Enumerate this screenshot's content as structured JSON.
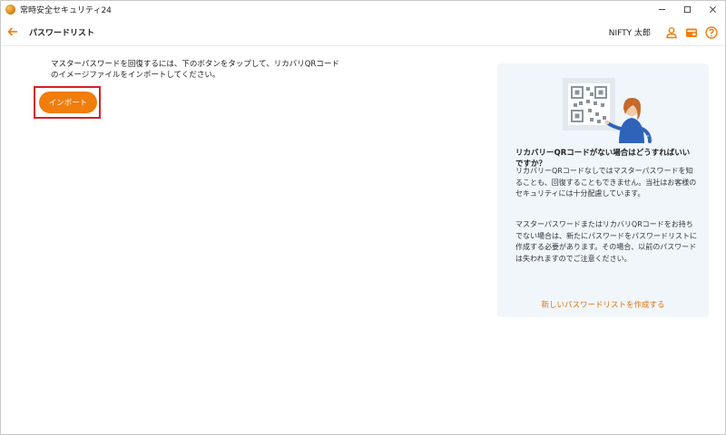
{
  "window": {
    "title": "常時安全セキュリティ24"
  },
  "header": {
    "title": "パスワードリスト",
    "user_name": "NIFTY 太郎"
  },
  "main": {
    "instruction": "マスターパスワードを回復するには、下のボタンをタップして、リカバリQRコードのイメージファイルをインポートしてください。",
    "import_label": "インポート"
  },
  "info_card": {
    "title": "リカバリーQRコードがない場合はどうすればいいですか？",
    "paragraph1": "リカバリーQRコードなしではマスターパスワードを知ることも、回復することもできません。当社はお客様のセキュリティには十分配慮しています。",
    "paragraph2": "マスターパスワードまたはリカバリQRコードをお持ちでない場合は、新たにパスワードをパスワードリストに作成する必要があります。その場合、以前のパスワードは失われますのでご注意ください。",
    "link": "新しいパスワードリストを作成する"
  },
  "colors": {
    "accent": "#f07d0c",
    "highlight_border": "#d62027",
    "card_background": "#f1f6fb"
  },
  "icons": {
    "back": "arrow-left-icon",
    "user": "user-icon",
    "card": "wallet-icon",
    "help": "question-icon"
  }
}
